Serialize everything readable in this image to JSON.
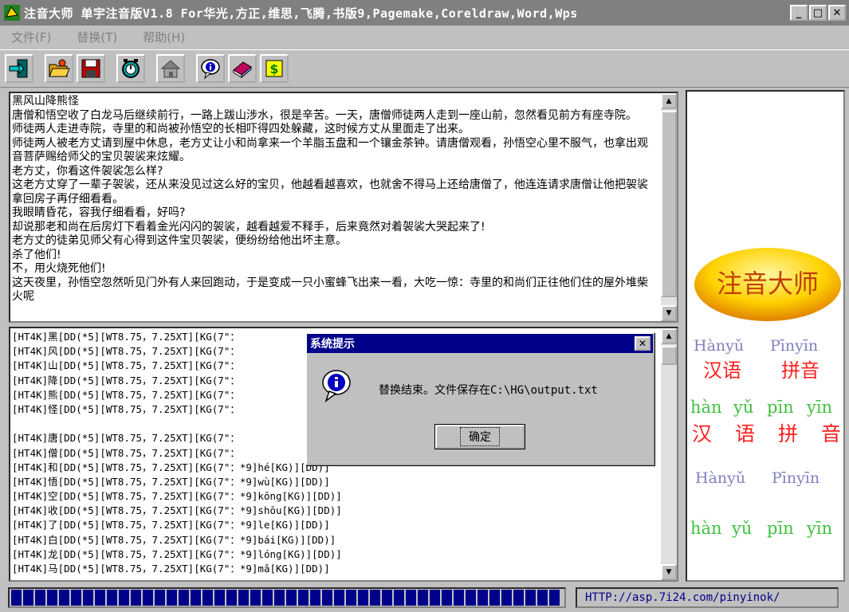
{
  "window": {
    "title": "注音大师 单宇注音版V1.8 For华光,方正,维思,飞腾,书版9,Pagemake,Coreldraw,Word,Wps",
    "minimize": "_",
    "maximize": "□",
    "close": "✕"
  },
  "menu": {
    "items": [
      {
        "label": "文件(F)"
      },
      {
        "label": "替换(T)"
      },
      {
        "label": "帮助(H)"
      }
    ]
  },
  "toolbar": {
    "buttons": [
      {
        "icon": "exit-door-icon"
      },
      {
        "icon": "open-folder-icon"
      },
      {
        "icon": "save-disk-icon"
      },
      {
        "icon": "clock-icon"
      },
      {
        "icon": "house-icon"
      },
      {
        "icon": "info-icon"
      },
      {
        "icon": "book-icon"
      },
      {
        "icon": "dollar-icon"
      }
    ]
  },
  "source_text": [
    "黑风山降熊怪",
    "唐僧和悟空收了白龙马后继续前行，一路上跋山涉水，很是辛苦。一天，唐僧师徒两人走到一座山前，忽然看见前方有座寺院。",
    "师徒两人走进寺院，寺里的和尚被孙悟空的长相吓得四处躲藏，这时候方丈从里面走了出来。",
    "师徒两人被老方丈请到屋中休息，老方丈让小和尚拿来一个羊脂玉盘和一个镶金茶钟。请唐僧观看，孙悟空心里不服气，也拿出观音菩萨赐给师父的宝贝袈裟来炫耀。",
    "老方丈，你看这件袈裟怎么样?",
    "这老方丈穿了一辈子袈裟，还从来没见过这么好的宝贝，他越看越喜欢，也就舍不得马上还给唐僧了，他连连请求唐僧让他把袈裟拿回房子再仔细看看。",
    "我眼睛昏花，容我仔细看看，好吗?",
    "却说那老和尚在后房灯下看着金光闪闪的袈裟，越看越爱不释手，后来竟然对着袈裟大哭起来了!",
    "老方丈的徒弟见师父有心得到这件宝贝袈裟，便纷纷给他出坏主意。",
    "杀了他们!",
    "不，用火烧死他们!",
    "这天夜里，孙悟空忽然听见门外有人来回跑动，于是变成一只小蜜蜂飞出来一看，大吃一惊：寺里的和尚们正往他们住的屋外堆柴火呢"
  ],
  "output_lines": [
    "[HT4K]黑[DD(*5][WT8.75，7.25XT][KG(7\"：",
    "[HT4K]风[DD(*5][WT8.75，7.25XT][KG(7\"：",
    "[HT4K]山[DD(*5][WT8.75，7.25XT][KG(7\"：",
    "[HT4K]降[DD(*5][WT8.75，7.25XT][KG(7\"：",
    "[HT4K]熊[DD(*5][WT8.75，7.25XT][KG(7\"：",
    "[HT4K]怪[DD(*5][WT8.75，7.25XT][KG(7\"：",
    "",
    "[HT4K]唐[DD(*5][WT8.75，7.25XT][KG(7\"：",
    "[HT4K]僧[DD(*5][WT8.75，7.25XT][KG(7\"：",
    "[HT4K]和[DD(*5][WT8.75，7.25XT][KG(7\"：*9]hé[KG)][DD)]",
    "[HT4K]悟[DD(*5][WT8.75，7.25XT][KG(7\"：*9]wù[KG)][DD)]",
    "[HT4K]空[DD(*5][WT8.75，7.25XT][KG(7\"：*9]kōng[KG)][DD)]",
    "[HT4K]收[DD(*5][WT8.75，7.25XT][KG(7\"：*9]shōu[KG)][DD)]",
    "[HT4K]了[DD(*5][WT8.75，7.25XT][KG(7\"：*9]le[KG)][DD)]",
    "[HT4K]白[DD(*5][WT8.75，7.25XT][KG(7\"：*9]bái[KG)][DD)]",
    "[HT4K]龙[DD(*5][WT8.75，7.25XT][KG(7\"：*9]lóng[KG)][DD)]",
    "[HT4K]马[DD(*5][WT8.75，7.25XT][KG(7\"：*9]mǎ[KG)][DD)]"
  ],
  "side_panel": {
    "logo_text": "注音大师",
    "row1_pinyin": [
      "Hànyǔ",
      "Pīnyīn"
    ],
    "row1_hanzi": [
      "汉语",
      "拼音"
    ],
    "row2_pinyin": [
      "hàn",
      "yǔ",
      "pīn",
      "yīn"
    ],
    "row2_hanzi": [
      "汉",
      "语",
      "拼",
      "音"
    ],
    "row3_pinyin": [
      "Hànyǔ",
      "Pīnyīn"
    ],
    "row4_pinyin": [
      "hàn",
      "yǔ",
      "pīn",
      "yīn"
    ],
    "colors": {
      "purple": "#8080c0",
      "red": "#ff2020",
      "green": "#40c040",
      "logo_text": "#c04000",
      "logo_fill": "#ffd200"
    }
  },
  "progress": {
    "fraction": 1.0,
    "color": "#00008b"
  },
  "status": {
    "url": "HTTP://asp.7i24.com/pinyinok/"
  },
  "dialog": {
    "title": "系统提示",
    "close": "✕",
    "message": "替换结束。文件保存在C:\\HG\\output.txt",
    "ok_label": "确定",
    "icon": "info-icon"
  }
}
